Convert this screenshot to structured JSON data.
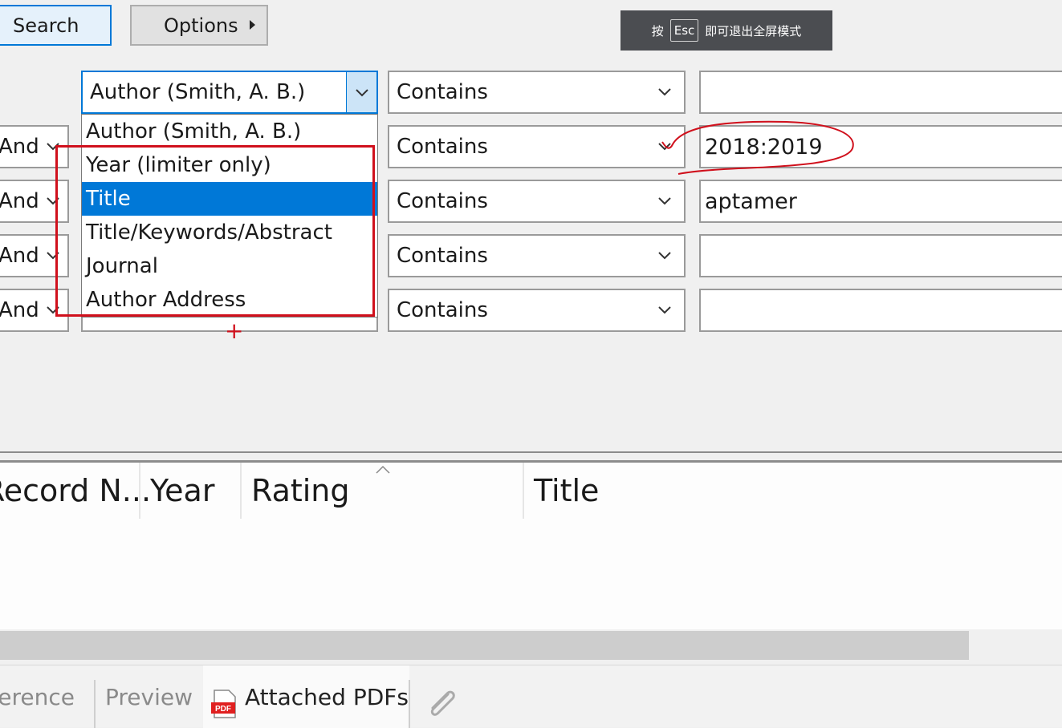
{
  "toolbar": {
    "search_label": "Search",
    "options_label": "Options"
  },
  "toast": {
    "prefix": "按",
    "key": "Esc",
    "suffix": "即可退出全屏模式"
  },
  "search_rows": [
    {
      "bool": "",
      "field": "Author (Smith, A. B.)",
      "condition": "Contains",
      "value": ""
    },
    {
      "bool": "And",
      "field": "",
      "condition": "Contains",
      "value": "2018:2019"
    },
    {
      "bool": "And",
      "field": "",
      "condition": "Contains",
      "value": "aptamer"
    },
    {
      "bool": "And",
      "field": "",
      "condition": "Contains",
      "value": ""
    },
    {
      "bool": "And",
      "field": "",
      "condition": "Contains",
      "value": ""
    }
  ],
  "field_dropdown": {
    "options": [
      "Author (Smith, A. B.)",
      "Year (limiter only)",
      "Title",
      "Title/Keywords/Abstract",
      "Journal",
      "Author Address"
    ],
    "selected": "Title"
  },
  "results": {
    "columns": [
      "Record N...",
      "Year",
      "Rating",
      "Title"
    ]
  },
  "tabs": [
    {
      "label": "Reference"
    },
    {
      "label": "Preview"
    },
    {
      "label": "Attached PDFs"
    }
  ],
  "icons": {
    "pdf": "pdf-file-icon",
    "attach": "paperclip-icon"
  },
  "colors": {
    "selection": "#0078d7",
    "annotation": "#d0101c"
  }
}
